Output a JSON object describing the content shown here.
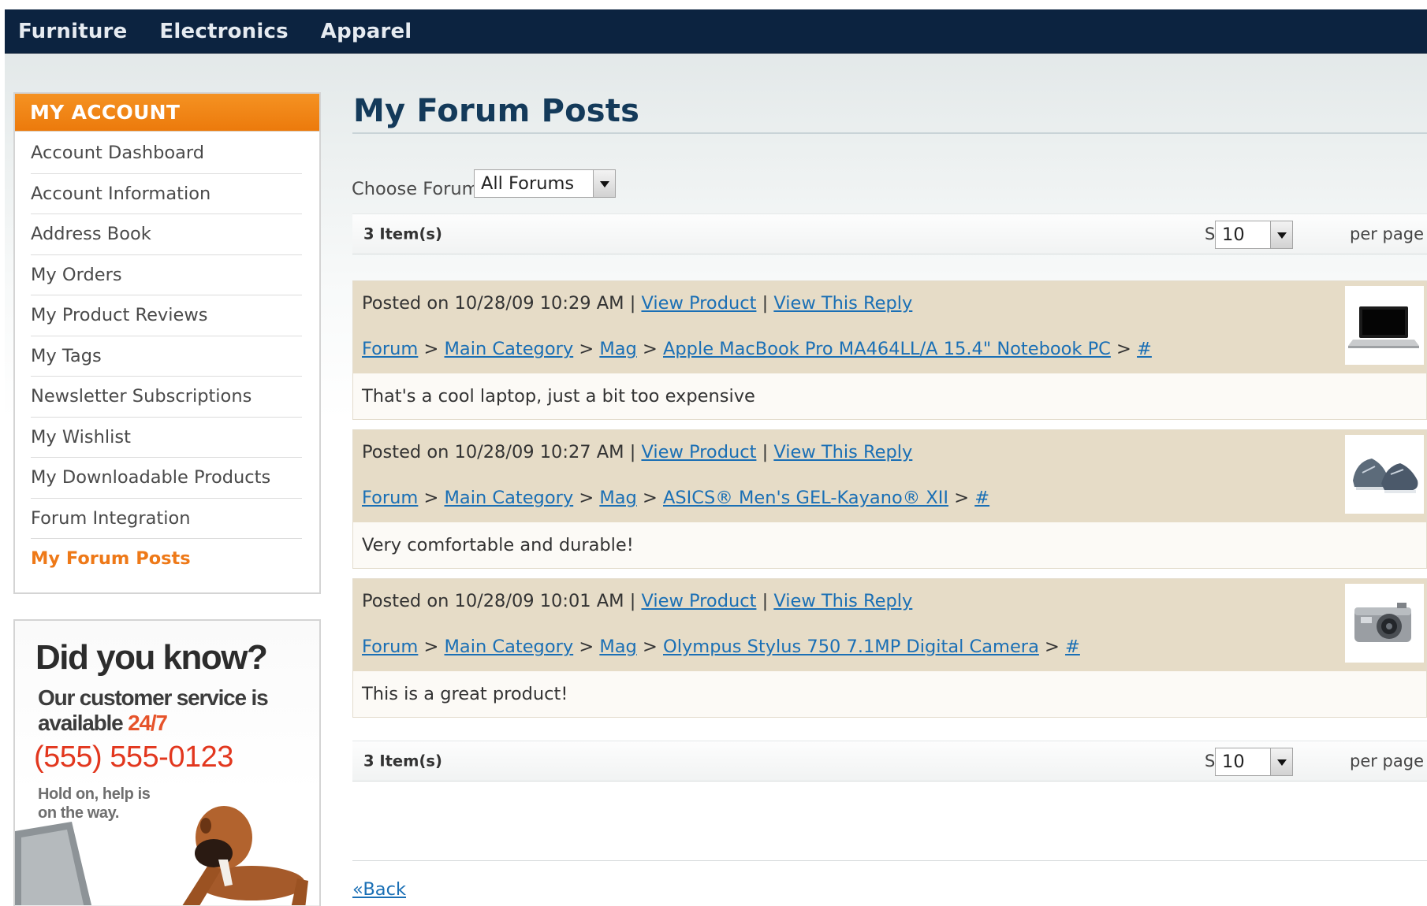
{
  "topnav": {
    "items": [
      {
        "label": "Furniture"
      },
      {
        "label": "Electronics"
      },
      {
        "label": "Apparel"
      }
    ]
  },
  "sidebar": {
    "title": "MY ACCOUNT",
    "items": [
      {
        "label": "Account Dashboard"
      },
      {
        "label": "Account Information"
      },
      {
        "label": "Address Book"
      },
      {
        "label": "My Orders"
      },
      {
        "label": "My Product Reviews"
      },
      {
        "label": "My Tags"
      },
      {
        "label": "Newsletter Subscriptions"
      },
      {
        "label": "My Wishlist"
      },
      {
        "label": "My Downloadable Products"
      },
      {
        "label": "Forum Integration"
      },
      {
        "label": "My Forum Posts",
        "active": true
      }
    ]
  },
  "promo": {
    "title": "Did you know?",
    "sub_prefix": "Our customer service is available",
    "sub_highlight": "24/7",
    "phone": "(555) 555-0123",
    "hold": "Hold on, help is on the way."
  },
  "main": {
    "title": "My Forum Posts",
    "choose_forum_label": "Choose Forum:",
    "forum_select_value": "All Forums",
    "toolbar_top": {
      "items": "3 Item(s)",
      "show": "Show",
      "per_page_value": "10",
      "per_page": "per page"
    },
    "toolbar_bottom": {
      "items": "3 Item(s)",
      "show": "Show",
      "per_page_value": "10",
      "per_page": "per page"
    },
    "posts": [
      {
        "posted": "Posted on 10/28/09 10:29 AM",
        "sep": "|",
        "view_product": "View Product",
        "view_reply": "View This Reply",
        "crumb_forum": "Forum",
        "crumb_category": "Main Category",
        "crumb_sub": "Mag",
        "crumb_product": "Apple MacBook Pro MA464LL/A 15.4\" Notebook PC",
        "crumb_hash": "#",
        "arrow": ">",
        "text": "That's a cool laptop, just a bit too expensive",
        "thumb": "laptop-thumbnail"
      },
      {
        "posted": "Posted on 10/28/09 10:27 AM",
        "sep": "|",
        "view_product": "View Product",
        "view_reply": "View This Reply",
        "crumb_forum": "Forum",
        "crumb_category": "Main Category",
        "crumb_sub": "Mag",
        "crumb_product": "ASICS® Men's GEL-Kayano® XII",
        "crumb_hash": "#",
        "arrow": ">",
        "text": "Very comfortable and durable!",
        "thumb": "shoes-thumbnail"
      },
      {
        "posted": "Posted on 10/28/09 10:01 AM",
        "sep": "|",
        "view_product": "View Product",
        "view_reply": "View This Reply",
        "crumb_forum": "Forum",
        "crumb_category": "Main Category",
        "crumb_sub": "Mag",
        "crumb_product": "Olympus Stylus 750 7.1MP Digital Camera",
        "crumb_hash": "#",
        "arrow": ">",
        "text": "This is a great product!",
        "thumb": "camera-thumbnail"
      }
    ],
    "back_link": "«Back"
  },
  "colors": {
    "nav_bg": "#0c2340",
    "accent_orange": "#ee7918",
    "link_blue": "#1a6fb5",
    "post_header_bg": "#e6dcc7",
    "phone_red": "#e2371e"
  }
}
